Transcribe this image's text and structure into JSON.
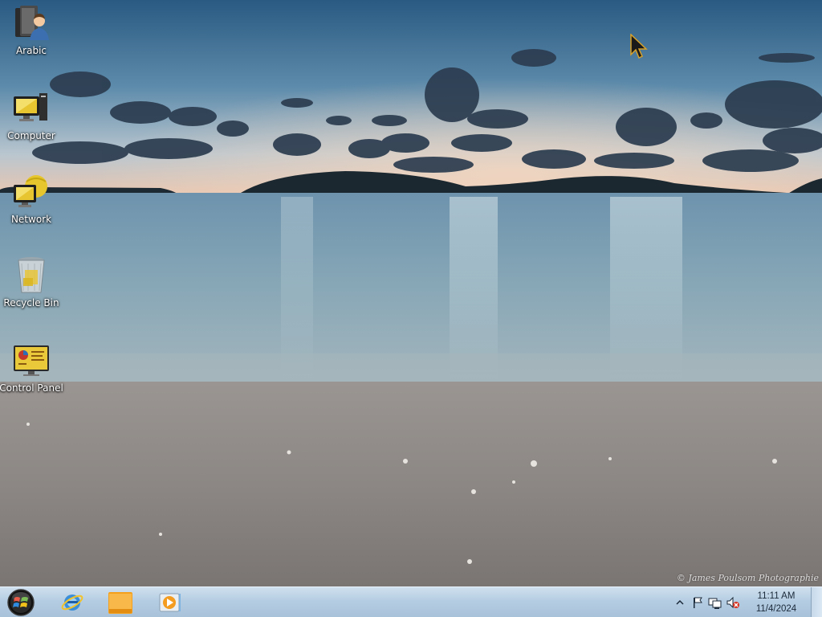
{
  "desktop": {
    "watermark": "© James Poulsom Photographie",
    "icons": [
      {
        "label": "Arabic",
        "icon": "user-folder-icon"
      },
      {
        "label": "Computer",
        "icon": "computer-icon"
      },
      {
        "label": "Network",
        "icon": "network-icon"
      },
      {
        "label": "Recycle Bin",
        "icon": "recycle-bin-icon"
      },
      {
        "label": "Control Panel",
        "icon": "control-panel-icon"
      }
    ]
  },
  "taskbar": {
    "start_icon": "start-orb-icon",
    "pinned": [
      {
        "name": "Internet Explorer",
        "icon": "internet-explorer-icon"
      },
      {
        "name": "Windows Explorer",
        "icon": "folder-icon"
      },
      {
        "name": "Windows Media Player",
        "icon": "media-player-icon"
      }
    ],
    "tray": {
      "icons": [
        "show-hidden-icons-icon",
        "action-center-flag-icon",
        "network-status-icon",
        "volume-muted-icon"
      ],
      "time": "11:11 AM",
      "date": "11/4/2024"
    }
  },
  "colors": {
    "taskbar_top": "#cfe0ef",
    "taskbar_bottom": "#a8c2da",
    "sky_top": "#2e5f86",
    "sand": "#8f8a88"
  }
}
